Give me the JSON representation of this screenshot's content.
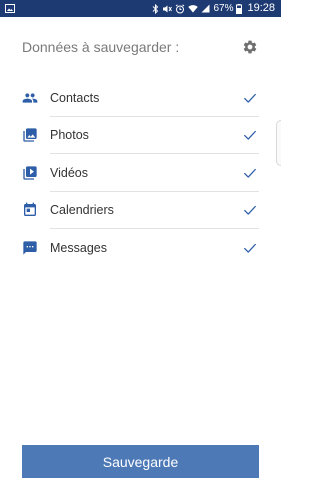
{
  "status_bar": {
    "battery_percent": "67%",
    "time": "19:28",
    "icons": [
      "gallery-icon",
      "bluetooth-icon",
      "mute-icon",
      "alarm-icon",
      "wifi-icon",
      "signal-icon",
      "battery-icon"
    ]
  },
  "header": {
    "title": "Données à sauvegarder :",
    "settings_icon": "gear-icon"
  },
  "items": [
    {
      "label": "Contacts",
      "icon": "people-icon",
      "checked": true
    },
    {
      "label": "Photos",
      "icon": "photo-icon",
      "checked": true
    },
    {
      "label": "Vidéos",
      "icon": "video-icon",
      "checked": true
    },
    {
      "label": "Calendriers",
      "icon": "calendar-icon",
      "checked": true
    },
    {
      "label": "Messages",
      "icon": "message-icon",
      "checked": true
    }
  ],
  "primary_button": {
    "label": "Sauvegarde"
  },
  "colors": {
    "status_bar": "#1e3a72",
    "accent": "#2f5ea8",
    "button": "#4d79b7",
    "title_text": "#7a7a7a"
  }
}
